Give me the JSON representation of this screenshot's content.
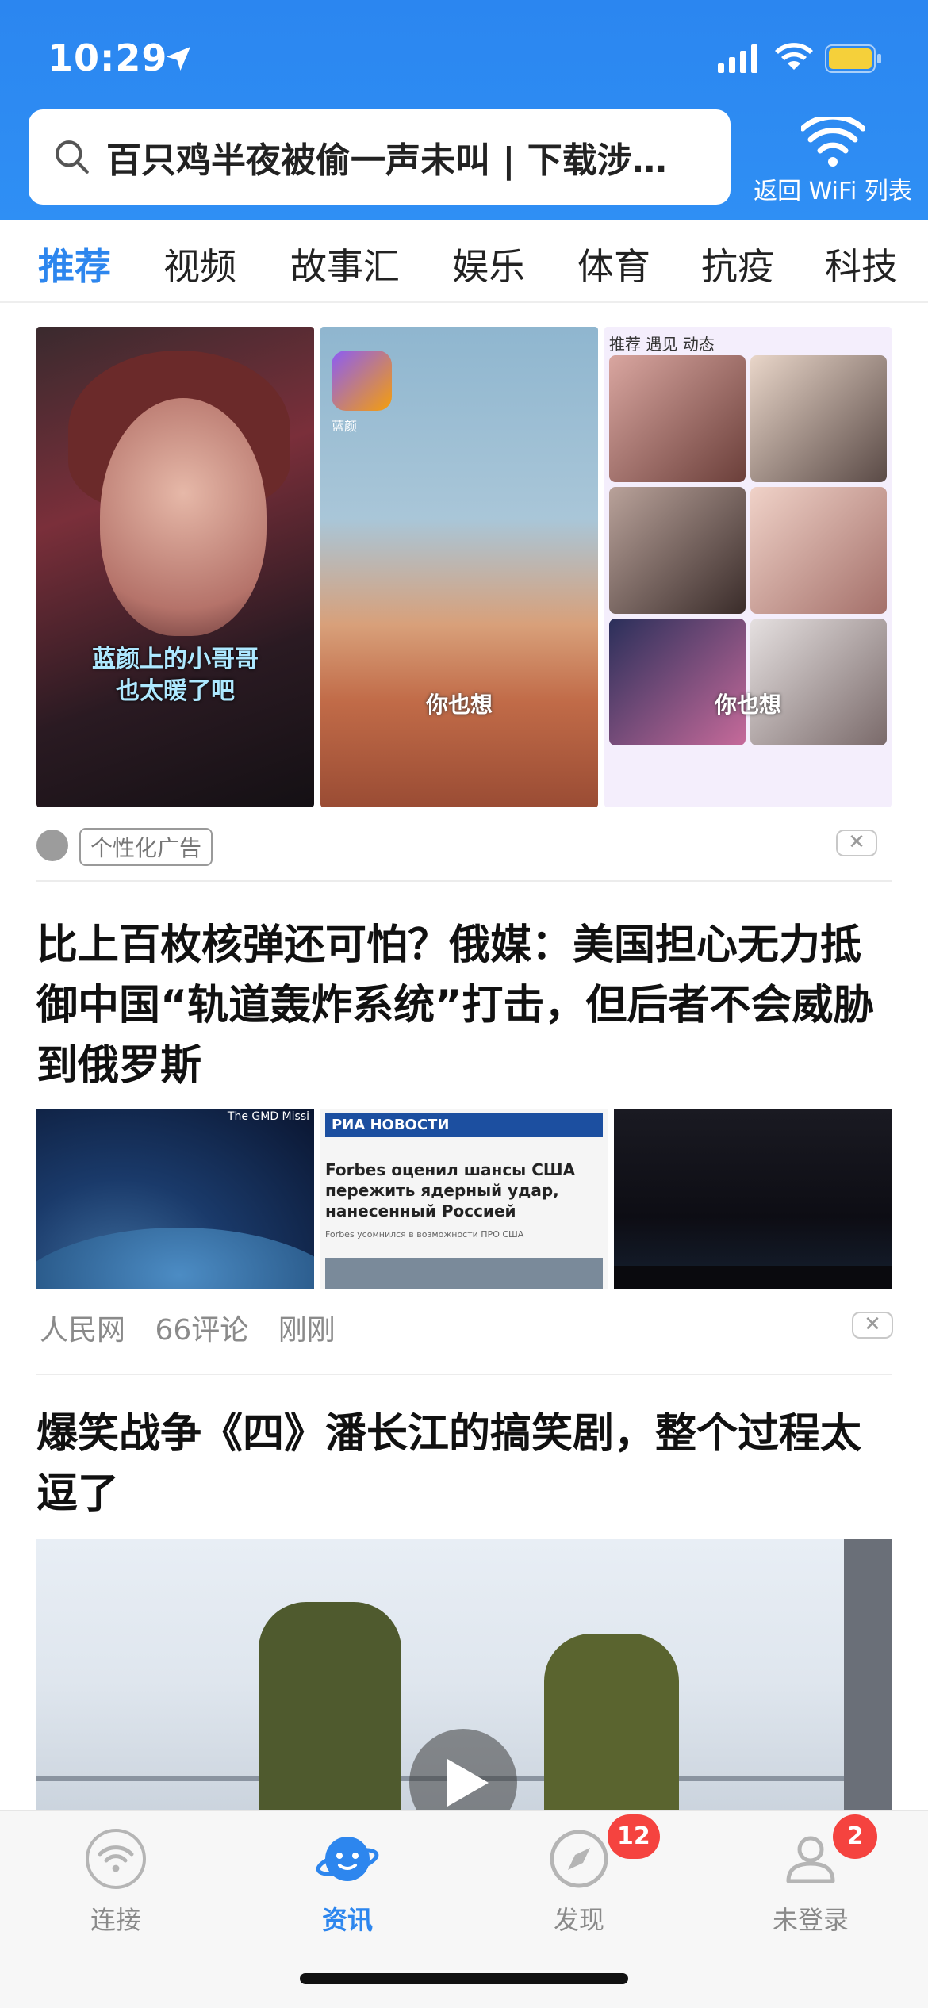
{
  "status": {
    "time": "10:29",
    "icons": [
      "location-arrow-icon",
      "signal-icon",
      "wifi-icon",
      "battery-icon"
    ],
    "battery_color": "#f5d03a"
  },
  "search": {
    "text": "百只鸡半夜被偷一声未叫 | 下载涉…"
  },
  "wifi_back": {
    "label": "返回 WiFi 列表"
  },
  "tabs": [
    {
      "label": "推荐",
      "active": true
    },
    {
      "label": "视频"
    },
    {
      "label": "故事汇"
    },
    {
      "label": "娱乐"
    },
    {
      "label": "体育"
    },
    {
      "label": "抗疫"
    },
    {
      "label": "科技"
    }
  ],
  "ad": {
    "image1_caption": "蓝颜上的小哥哥\n也太暖了吧",
    "image2_caption": "你也想",
    "image2_app_name": "蓝颜",
    "image3_caption": "你也想",
    "image3_tabs": "推荐  遇见  动态",
    "tag": "个性化广告",
    "close": "✕"
  },
  "article1": {
    "title": "比上百枚核弹还可怕？俄媒：美国担心无力抵御中国“轨道轰炸系统”打击，但后者不会威胁到俄罗斯",
    "image1_label": "The GMD Missi",
    "image2_source": "РИА НОВОСТИ",
    "image2_headline": "Forbes оценил шансы США пережить ядерный удар, нанесенный Россией",
    "image2_sub": "Forbes усомнился в возможности ПРО США",
    "source": "人民网",
    "comments": "66评论",
    "time": "刚刚",
    "close": "✕"
  },
  "article2": {
    "title": "爆笑战争《四》潘长江的搞笑剧，整个过程太逗了"
  },
  "bottom_nav": [
    {
      "label": "连接",
      "icon": "wifi-icon"
    },
    {
      "label": "资讯",
      "icon": "planet-icon",
      "active": true
    },
    {
      "label": "发现",
      "icon": "compass-icon",
      "badge": "12"
    },
    {
      "label": "未登录",
      "icon": "user-icon",
      "badge": "2"
    }
  ],
  "colors": {
    "accent": "#2d86ee",
    "header_bg": "#2f8ff4",
    "badge": "#f5433f"
  }
}
